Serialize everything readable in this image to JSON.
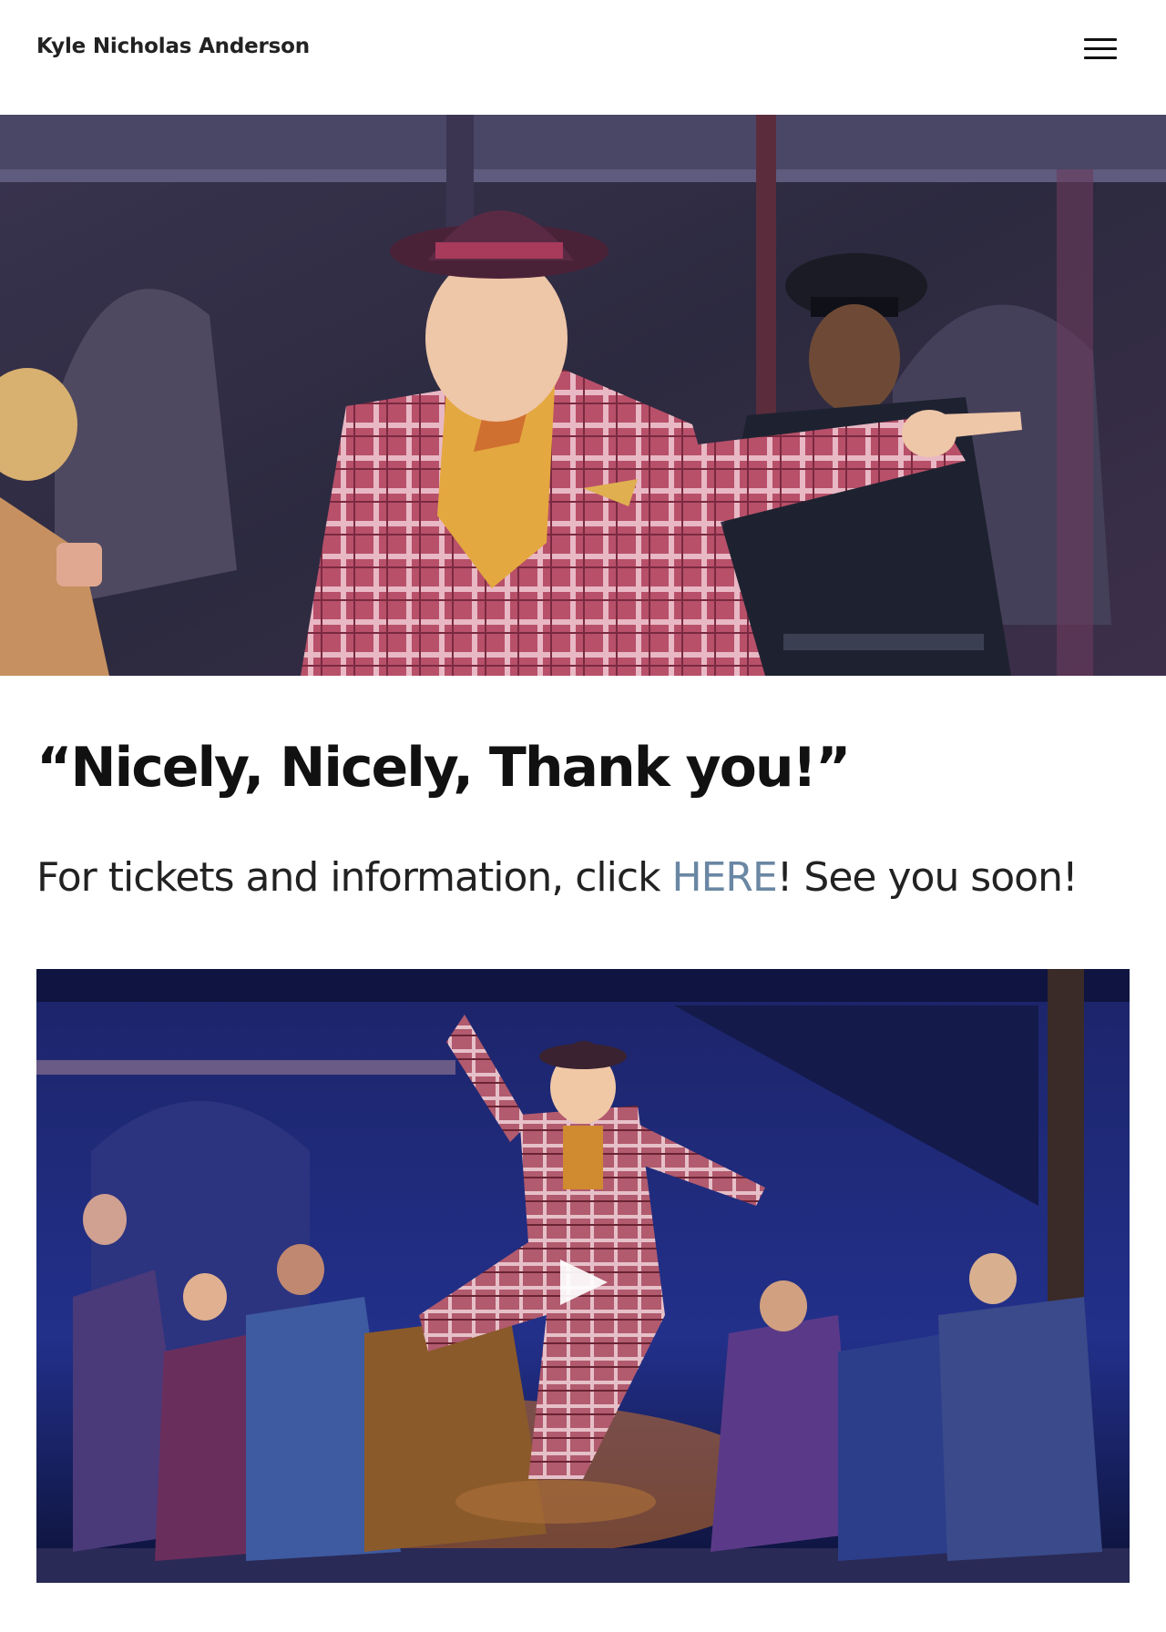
{
  "header": {
    "site_title": "Kyle Nicholas Anderson",
    "menu_icon": "hamburger-menu-icon"
  },
  "hero": {
    "image": "performer-in-plaid-suit-pointing"
  },
  "content": {
    "heading": "“Nicely, Nicely, Thank you!”",
    "text_before": "For tickets and information, click ",
    "link_text": "HERE",
    "text_after": "!  See you soon!"
  },
  "video": {
    "play_icon": "play-icon"
  },
  "colors": {
    "link": "#6a87a3",
    "text": "#222222"
  }
}
